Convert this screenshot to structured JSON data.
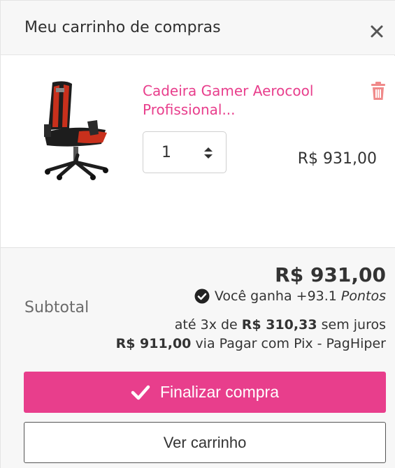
{
  "header": {
    "title": "Meu carrinho de compras",
    "close_icon": "close-icon"
  },
  "item": {
    "name_line1": "Cadeira Gamer Aerocool",
    "name_line2": "Profissional...",
    "image_icon": "gaming-chair-image",
    "delete_icon": "trash-icon",
    "quantity": "1",
    "price": "R$ 931,00"
  },
  "summary": {
    "subtotal_label": "Subtotal",
    "total": "R$ 931,00",
    "points_prefix": "Você ganha +93.1",
    "points_suffix": "Pontos",
    "installments_prefix": "até 3x de",
    "installments_value": "R$ 310,33",
    "installments_suffix": "sem juros",
    "pix_value": "R$ 911,00",
    "pix_suffix": "via Pagar com Pix - PagHiper"
  },
  "buttons": {
    "checkout_label": "Finalizar compra",
    "view_cart_label": "Ver carrinho"
  },
  "colors": {
    "accent": "#e83e8c",
    "header_bg": "#f7f7f7",
    "trash": "#f08a8a"
  }
}
